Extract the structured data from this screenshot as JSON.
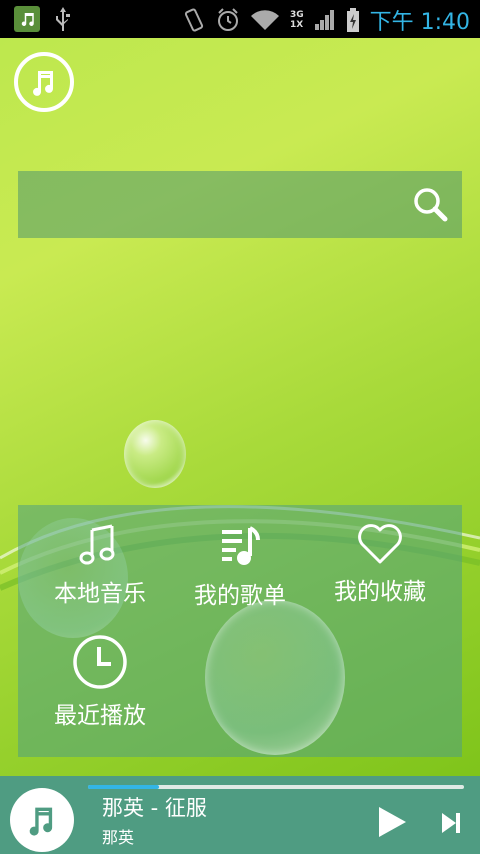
{
  "status_bar": {
    "time": "下午 1:40",
    "network_top": "3G",
    "network_bottom": "1X"
  },
  "search": {
    "placeholder": ""
  },
  "menu": {
    "items": [
      {
        "label": "本地音乐",
        "icon": "music-note-icon"
      },
      {
        "label": "我的歌单",
        "icon": "playlist-icon"
      },
      {
        "label": "我的收藏",
        "icon": "heart-icon"
      },
      {
        "label": "最近播放",
        "icon": "clock-icon"
      }
    ]
  },
  "player": {
    "title": "那英 - 征服",
    "artist": "那英",
    "progress": 0.19
  },
  "colors": {
    "accent": "#33b5e5",
    "panel": "#50a082",
    "player_bg": "#4f9c82",
    "background": "#a8da3a"
  }
}
